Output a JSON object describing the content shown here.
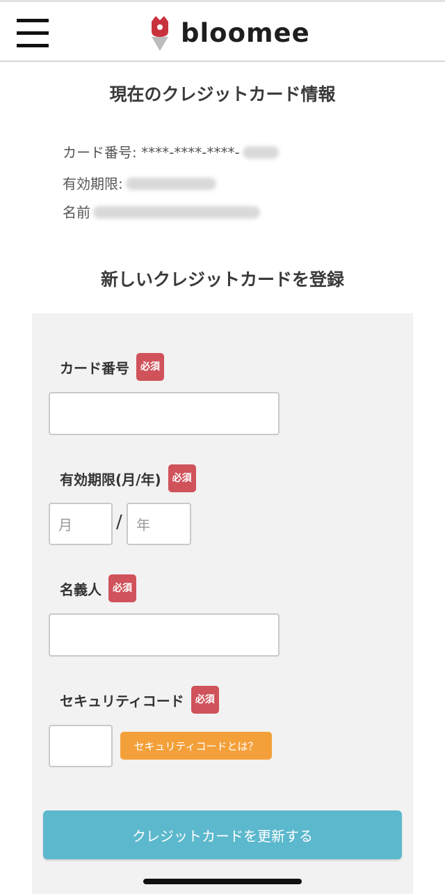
{
  "header": {
    "logo_text": "bloomee",
    "menu_icon": "hamburger-menu-icon",
    "logo_icon": "flower-logo-icon"
  },
  "current_card": {
    "title": "現在のクレジットカード情報",
    "card_number_label": "カード番号: ****-****-****-",
    "expiry_label": "有効期限: ",
    "name_label": "名前"
  },
  "new_card": {
    "title": "新しいクレジットカードを登録",
    "required_badge": "必須",
    "card_number_label": "カード番号",
    "expiry_label": "有効期限(月/年)",
    "month_placeholder": "月",
    "slash": "/",
    "year_placeholder": "年",
    "holder_label": "名義人",
    "security_label": "セキュリティコード",
    "security_help": "セキュリティコードとは？",
    "submit_label": "クレジットカードを更新する"
  },
  "colors": {
    "required": "#d0525b",
    "help": "#f3a03a",
    "submit": "#5cb8cc",
    "panel": "#f2f2f2",
    "logo_accent": "#c8323c"
  }
}
